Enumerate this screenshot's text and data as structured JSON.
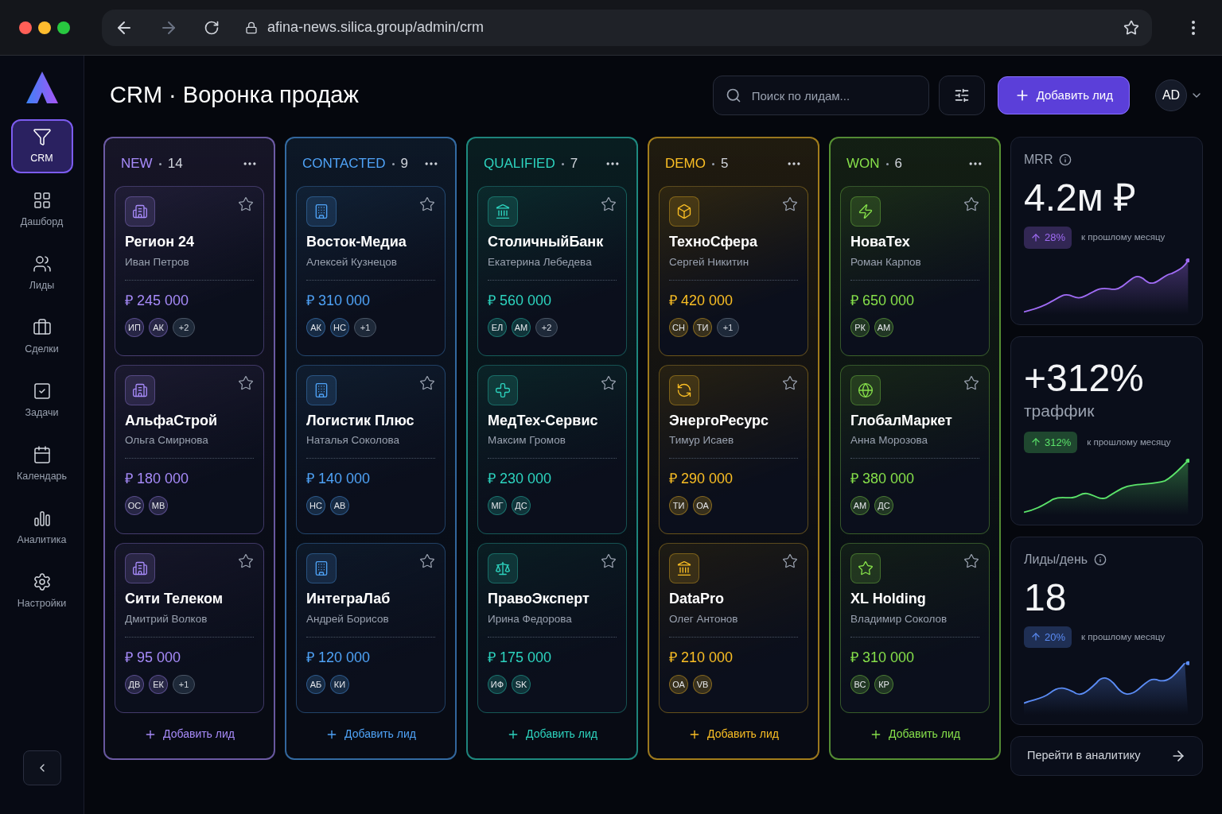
{
  "browser": {
    "url": "afina-news.silica.group/admin/crm"
  },
  "sidebar": {
    "items": [
      {
        "label": "CRM",
        "selected": true
      },
      {
        "label": "Дашборд",
        "selected": false
      },
      {
        "label": "Лиды",
        "selected": false
      },
      {
        "label": "Сделки",
        "selected": false
      },
      {
        "label": "Задачи",
        "selected": false
      },
      {
        "label": "Календарь",
        "selected": false
      },
      {
        "label": "Аналитика",
        "selected": false
      },
      {
        "label": "Настройки",
        "selected": false
      }
    ]
  },
  "header": {
    "title": "CRM · Воронка продаж",
    "search": {
      "placeholder": "Поиск по лидам..."
    },
    "add_button": "Добавить лид",
    "user": "AD"
  },
  "columns": [
    {
      "title": "NEW",
      "count": "14",
      "color": "#a78bfa",
      "add": "Добавить лид",
      "cards": [
        {
          "company": "Регион 24",
          "contact": "Иван Петров",
          "amount": "₽ 245 000",
          "avatars": [
            "ИП",
            "АК"
          ],
          "extra": "+2"
        },
        {
          "company": "АльфаСтрой",
          "contact": "Ольга Смирнова",
          "amount": "₽ 180 000",
          "avatars": [
            "ОС",
            "МВ"
          ]
        },
        {
          "company": "Сити Телеком",
          "contact": "Дмитрий Волков",
          "amount": "₽ 95 000",
          "avatars": [
            "ДВ",
            "ЕК"
          ],
          "extra": "+1"
        }
      ]
    },
    {
      "title": "CONTACTED",
      "count": "9",
      "color": "#4fa3f7",
      "add": "Добавить лид",
      "cards": [
        {
          "company": "Восток-Медиа",
          "contact": "Алексей Кузнецов",
          "amount": "₽ 310 000",
          "avatars": [
            "АК",
            "НС"
          ],
          "extra": "+1"
        },
        {
          "company": "Логистик Плюс",
          "contact": "Наталья Соколова",
          "amount": "₽ 140 000",
          "avatars": [
            "НС",
            "АВ"
          ]
        },
        {
          "company": "ИнтеграЛаб",
          "contact": "Андрей Борисов",
          "amount": "₽ 120 000",
          "avatars": [
            "АБ",
            "КИ"
          ]
        }
      ]
    },
    {
      "title": "QUALIFIED",
      "count": "7",
      "color": "#2dd4bf",
      "add": "Добавить лид",
      "cards": [
        {
          "company": "СтоличныйБанк",
          "contact": "Екатерина Лебедева",
          "amount": "₽ 560 000",
          "avatars": [
            "ЕЛ",
            "АМ"
          ],
          "extra": "+2"
        },
        {
          "company": "МедТех-Сервис",
          "contact": "Максим Громов",
          "amount": "₽ 230 000",
          "avatars": [
            "МГ",
            "ДС"
          ]
        },
        {
          "company": "ПравоЭксперт",
          "contact": "Ирина Федорова",
          "amount": "₽ 175 000",
          "avatars": [
            "ИФ",
            "SK"
          ]
        }
      ]
    },
    {
      "title": "DEMO",
      "count": "5",
      "color": "#fbbf24",
      "add": "Добавить лид",
      "cards": [
        {
          "company": "ТехноСфера",
          "contact": "Сергей Никитин",
          "amount": "₽ 420 000",
          "avatars": [
            "СН",
            "ТИ"
          ],
          "extra": "+1"
        },
        {
          "company": "ЭнергоРесурс",
          "contact": "Тимур Исаев",
          "amount": "₽ 290 000",
          "avatars": [
            "ТИ",
            "ОА"
          ]
        },
        {
          "company": "DataPro",
          "contact": "Олег Антонов",
          "amount": "₽ 210 000",
          "avatars": [
            "ОА",
            "VB"
          ]
        }
      ]
    },
    {
      "title": "WON",
      "count": "6",
      "color": "#86e04a",
      "add": "Добавить лид",
      "cards": [
        {
          "company": "НоваТех",
          "contact": "Роман Карпов",
          "amount": "₽ 650 000",
          "avatars": [
            "РК",
            "АМ"
          ]
        },
        {
          "company": "ГлобалМаркет",
          "contact": "Анна Морозова",
          "amount": "₽ 380 000",
          "avatars": [
            "АМ",
            "ДС"
          ]
        },
        {
          "company": "XL Holding",
          "contact": "Владимир Соколов",
          "amount": "₽ 310 000",
          "avatars": [
            "ВС",
            "КР"
          ]
        }
      ]
    }
  ],
  "stats": [
    {
      "label": "MRR",
      "info": true,
      "value": "4.2м ₽",
      "change": "28%",
      "note": "к прошлому месяцу",
      "color": "#a06cf5"
    },
    {
      "value": "+312%",
      "caption": "траффик",
      "change": "312%",
      "note": "к прошлому месяцу",
      "color": "#5be36a"
    },
    {
      "label": "Лиды/день",
      "info": true,
      "value": "18",
      "change": "20%",
      "note": "к прошлому месяцу",
      "color": "#5b8cf5"
    }
  ],
  "analytics_link": "Перейти в аналитику"
}
